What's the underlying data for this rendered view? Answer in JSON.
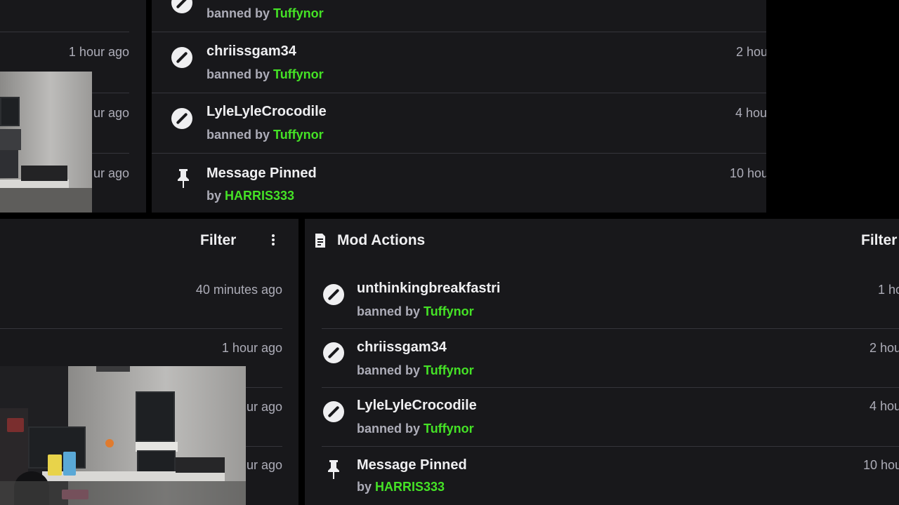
{
  "top_left_panel": {
    "times": [
      "1 hour ago",
      "ur ago",
      "ur ago"
    ]
  },
  "top_right_panel": {
    "rows": [
      {
        "type": "ban",
        "name": "",
        "by_prefix": "banned by",
        "moderator": "Tuffynor",
        "time": ""
      },
      {
        "type": "ban",
        "name": "chriissgam34",
        "by_prefix": "banned by",
        "moderator": "Tuffynor",
        "time": "2 hou"
      },
      {
        "type": "ban",
        "name": "LyleLyleCrocodile",
        "by_prefix": "banned by",
        "moderator": "Tuffynor",
        "time": "4 hou"
      },
      {
        "type": "pin",
        "name": "Message Pinned",
        "by_prefix": "by",
        "moderator": "HARRIS333",
        "time": "10 hou"
      }
    ]
  },
  "bottom_left_panel": {
    "filter_label": "Filter",
    "times": [
      "40 minutes ago",
      "1 hour ago",
      "ur ago",
      "ur ago"
    ]
  },
  "bottom_right_panel": {
    "title": "Mod Actions",
    "filter_label": "Filter",
    "rows": [
      {
        "type": "ban",
        "name": "unthinkingbreakfastri",
        "by_prefix": "banned by",
        "moderator": "Tuffynor",
        "time": "1 ho"
      },
      {
        "type": "ban",
        "name": "chriissgam34",
        "by_prefix": "banned by",
        "moderator": "Tuffynor",
        "time": "2 hou"
      },
      {
        "type": "ban",
        "name": "LyleLyleCrocodile",
        "by_prefix": "banned by",
        "moderator": "Tuffynor",
        "time": "4 hou"
      },
      {
        "type": "pin",
        "name": "Message Pinned",
        "by_prefix": "by",
        "moderator": "HARRIS333",
        "time": "10 hou"
      }
    ]
  },
  "icons": {
    "ban": "ban-icon",
    "pin": "pin-icon",
    "mod_actions": "document-icon",
    "more": "more-vertical-icon"
  },
  "colors": {
    "background": "#000000",
    "panel": "#18181b",
    "text": "#efeff1",
    "muted": "#adadb8",
    "moderator": "#45e226",
    "separator": "#35353b"
  }
}
